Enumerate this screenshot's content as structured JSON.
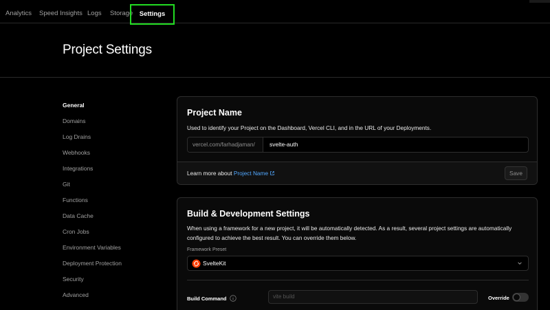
{
  "topnav": {
    "tabs": [
      {
        "label": "Analytics"
      },
      {
        "label": "Speed Insights"
      },
      {
        "label": "Logs"
      },
      {
        "label": "Storage"
      },
      {
        "label": "Settings",
        "active": true
      }
    ],
    "highlight_color": "#22dd22"
  },
  "header": {
    "title": "Project Settings"
  },
  "sidebar": {
    "items": [
      {
        "label": "General",
        "active": true
      },
      {
        "label": "Domains"
      },
      {
        "label": "Log Drains"
      },
      {
        "label": "Webhooks"
      },
      {
        "label": "Integrations"
      },
      {
        "label": "Git"
      },
      {
        "label": "Functions"
      },
      {
        "label": "Data Cache"
      },
      {
        "label": "Cron Jobs"
      },
      {
        "label": "Environment Variables"
      },
      {
        "label": "Deployment Protection"
      },
      {
        "label": "Security"
      },
      {
        "label": "Advanced"
      }
    ]
  },
  "project_name": {
    "title": "Project Name",
    "description": "Used to identify your Project on the Dashboard, Vercel CLI, and in the URL of your Deployments.",
    "prefix": "vercel.com/farhadjaman/",
    "value": "svelte-auth",
    "footer_text": "Learn more about ",
    "footer_link": "Project Name",
    "save_label": "Save"
  },
  "build_settings": {
    "title": "Build & Development Settings",
    "description": "When using a framework for a new project, it will be automatically detected. As a result, several project settings are automatically configured to achieve the best result. You can override them below.",
    "framework_label": "Framework Preset",
    "framework_value": "SvelteKit",
    "framework_icon": "svelte-icon",
    "build_command_label": "Build Command",
    "build_command_placeholder": "vite build",
    "override_label": "Override",
    "override_on": false
  },
  "colors": {
    "link": "#52a8ff",
    "svelte": "#ff3e00"
  }
}
